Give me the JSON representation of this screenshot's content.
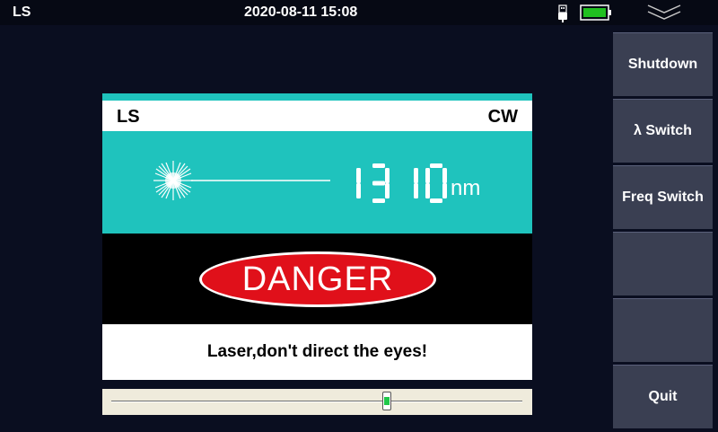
{
  "status": {
    "app_name": "LS",
    "datetime": "2020-08-11 15:08"
  },
  "panel": {
    "mode_label": "LS",
    "modulation_label": "CW",
    "wavelength_value": "1310",
    "wavelength_unit": "nm",
    "danger_label": "DANGER",
    "warning_message": "Laser,don't direct the eyes!"
  },
  "slider": {
    "position_fraction": 0.67
  },
  "sidebar": {
    "buttons": [
      {
        "label": "Shutdown"
      },
      {
        "label": "λ Switch"
      },
      {
        "label": "Freq Switch"
      },
      {
        "label": ""
      },
      {
        "label": ""
      },
      {
        "label": "Quit"
      }
    ]
  },
  "colors": {
    "accent_teal": "#1fc3bd",
    "danger_red": "#e0101a",
    "battery_green": "#20c020",
    "sidebar_button": "#3a3f52"
  },
  "icons": {
    "usb": "usb-icon",
    "battery": "battery-icon",
    "menu": "double-chevron-down-icon",
    "laser": "laser-starburst-icon"
  }
}
